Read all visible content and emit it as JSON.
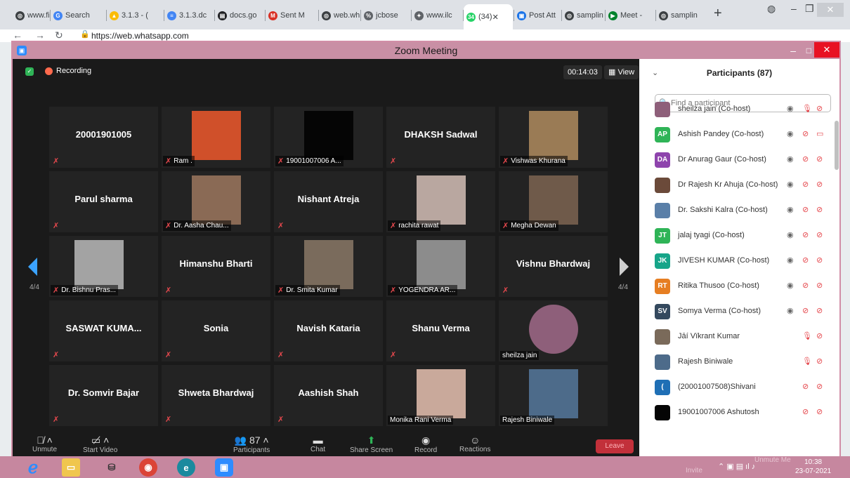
{
  "browser": {
    "tabs": [
      {
        "label": "www.fir",
        "icon": "chrome-icon",
        "color": "#3c4043",
        "glyph": "◎"
      },
      {
        "label": "Search",
        "icon": "google-icon",
        "color": "#4285f4",
        "glyph": "G"
      },
      {
        "label": "3.1.3 - (",
        "icon": "drive-icon",
        "color": "#fbbc04",
        "glyph": "▲"
      },
      {
        "label": "3.1.3.dc",
        "icon": "docs-icon",
        "color": "#4285f4",
        "glyph": "≡"
      },
      {
        "label": "docs.go",
        "icon": "slides-icon",
        "color": "#202124",
        "glyph": "▤"
      },
      {
        "label": "Sent M",
        "icon": "gmail-icon",
        "color": "#d93025",
        "glyph": "M"
      },
      {
        "label": "web.wh",
        "icon": "web-icon",
        "color": "#3c4043",
        "glyph": "◎"
      },
      {
        "label": "jcbose",
        "icon": "jcbose-icon",
        "color": "#5f6368",
        "glyph": "%"
      },
      {
        "label": "www.ilc",
        "icon": "ilc-icon",
        "color": "#5f6368",
        "glyph": "✦"
      },
      {
        "label": "(34)",
        "icon": "whatsapp-icon",
        "color": "#25d366",
        "glyph": "34"
      },
      {
        "label": "Post Att",
        "icon": "post-icon",
        "color": "#1a73e8",
        "glyph": "▣"
      },
      {
        "label": "samplin",
        "icon": "chrome-icon",
        "color": "#3c4043",
        "glyph": "◎"
      },
      {
        "label": "Meet -",
        "icon": "meet-icon",
        "color": "#00832d",
        "glyph": "▶"
      },
      {
        "label": "samplin",
        "icon": "chrome-icon",
        "color": "#3c4043",
        "glyph": "◎"
      }
    ],
    "url": "https://web.whatsapp.com",
    "new_tab": "+"
  },
  "zoom": {
    "window_title": "Zoom Meeting",
    "recording_label": "Recording",
    "timer": "00:14:03",
    "view_label": "View",
    "page_indicator_left": "4/4",
    "page_indicator_right": "4/4",
    "tiles": [
      {
        "name": "20001901005",
        "caption": "",
        "photo": false
      },
      {
        "name": "",
        "caption": "Ram .",
        "photo": true,
        "photo_color": "#d0502a"
      },
      {
        "name": "",
        "caption": "19001007006 A...",
        "photo": true,
        "photo_color": "#050505"
      },
      {
        "name": "DHAKSH Sadwal",
        "caption": "",
        "photo": false
      },
      {
        "name": "",
        "caption": "Vishwas Khurana",
        "photo": true,
        "photo_color": "#9a7b55"
      },
      {
        "name": "Parul sharma",
        "caption": "",
        "photo": false
      },
      {
        "name": "",
        "caption": "Dr. Aasha Chau...",
        "photo": true,
        "photo_color": "#8a6a55"
      },
      {
        "name": "Nishant Atreja",
        "caption": "",
        "photo": false
      },
      {
        "name": "",
        "caption": "rachita rawat",
        "photo": true,
        "photo_color": "#b9a7a0"
      },
      {
        "name": "",
        "caption": "Megha Dewan",
        "photo": true,
        "photo_color": "#6f5a4a"
      },
      {
        "name": "",
        "caption": "Dr. Bishnu Pras...",
        "photo": true,
        "photo_color": "#a3a3a3"
      },
      {
        "name": "Himanshu Bharti",
        "caption": "",
        "photo": false
      },
      {
        "name": "",
        "caption": "Dr. Smita Kumar",
        "photo": true,
        "photo_color": "#7a6b5c"
      },
      {
        "name": "",
        "caption": "YOGENDRA AR...",
        "photo": true,
        "photo_color": "#8c8c8c"
      },
      {
        "name": "Vishnu Bhardwaj",
        "caption": "",
        "photo": false
      },
      {
        "name": "SASWAT KUMA...",
        "caption": "",
        "photo": false
      },
      {
        "name": "Sonia",
        "caption": "",
        "photo": false
      },
      {
        "name": "Navish Kataria",
        "caption": "",
        "photo": false
      },
      {
        "name": "Shanu Verma",
        "caption": "",
        "photo": false
      },
      {
        "name": "",
        "caption": "sheilza jain",
        "photo": true,
        "photo_color": "#8e5f7a"
      },
      {
        "name": "Dr. Somvir Bajar",
        "caption": "",
        "photo": false
      },
      {
        "name": "Shweta Bhardwaj",
        "caption": "",
        "photo": false
      },
      {
        "name": "Aashish Shah",
        "caption": "",
        "photo": false
      },
      {
        "name": "",
        "caption": "Monika Rani Verma",
        "photo": true,
        "photo_color": "#c9a99b"
      },
      {
        "name": "",
        "caption": "Rajesh Biniwale",
        "photo": true,
        "photo_color": "#4d6b8a"
      }
    ],
    "toolbar": {
      "mute": "Unmute",
      "video": "Start Video",
      "participants": "Participants",
      "participants_count": "87",
      "chat": "Chat",
      "share": "Share Screen",
      "record": "Record",
      "reactions": "Reactions",
      "leave": "Leave"
    },
    "panel": {
      "title": "Participants (87)",
      "search_placeholder": "Find a participant",
      "invite": "Invite",
      "unmute_me": "Unmute Me",
      "participants": [
        {
          "initials": "",
          "name": "sheilza jain (Co-host)",
          "color": "#8e5f7a",
          "icons": [
            "◉",
            "🎙",
            "⊘"
          ]
        },
        {
          "initials": "AP",
          "name": "Ashish Pandey (Co-host)",
          "color": "#2fb457",
          "icons": [
            "◉",
            "⊘",
            "▭"
          ]
        },
        {
          "initials": "DA",
          "name": "Dr Anurag Gaur (Co-host)",
          "color": "#8e44ad",
          "icons": [
            "◉",
            "⊘",
            "⊘"
          ]
        },
        {
          "initials": "",
          "name": "Dr Rajesh Kr Ahuja (Co-host)",
          "color": "#6b4a3a",
          "icons": [
            "◉",
            "⊘",
            "⊘"
          ]
        },
        {
          "initials": "",
          "name": "Dr. Sakshi Kalra (Co-host)",
          "color": "#5a7fa8",
          "icons": [
            "◉",
            "⊘",
            "⊘"
          ]
        },
        {
          "initials": "JT",
          "name": "jalaj tyagi (Co-host)",
          "color": "#2fb457",
          "icons": [
            "◉",
            "⊘",
            "⊘"
          ]
        },
        {
          "initials": "JK",
          "name": "JIVESH KUMAR (Co-host)",
          "color": "#17a589",
          "icons": [
            "◉",
            "⊘",
            "⊘"
          ]
        },
        {
          "initials": "RT",
          "name": "Ritika Thusoo (Co-host)",
          "color": "#e67e22",
          "icons": [
            "◉",
            "⊘",
            "⊘"
          ]
        },
        {
          "initials": "SV",
          "name": "Somya Verma (Co-host)",
          "color": "#34495e",
          "icons": [
            "◉",
            "⊘",
            "⊘"
          ]
        },
        {
          "initials": "",
          "name": "Jāí Vïkrant Kumar",
          "color": "#7a6a5a",
          "icons": [
            "",
            "🎙",
            "⊘"
          ]
        },
        {
          "initials": "",
          "name": "Rajesh Biniwale",
          "color": "#4d6b8a",
          "icons": [
            "",
            "🎙",
            "⊘"
          ]
        },
        {
          "initials": "(",
          "name": "(20001007508)Shivani",
          "color": "#1f6fb5",
          "icons": [
            "",
            "⊘",
            "⊘"
          ]
        },
        {
          "initials": "",
          "name": "19001007006 Ashutosh",
          "color": "#050505",
          "icons": [
            "",
            "⊘",
            "⊘"
          ]
        }
      ]
    }
  },
  "taskbar": {
    "time": "10:38",
    "date": "23-07-2021"
  }
}
